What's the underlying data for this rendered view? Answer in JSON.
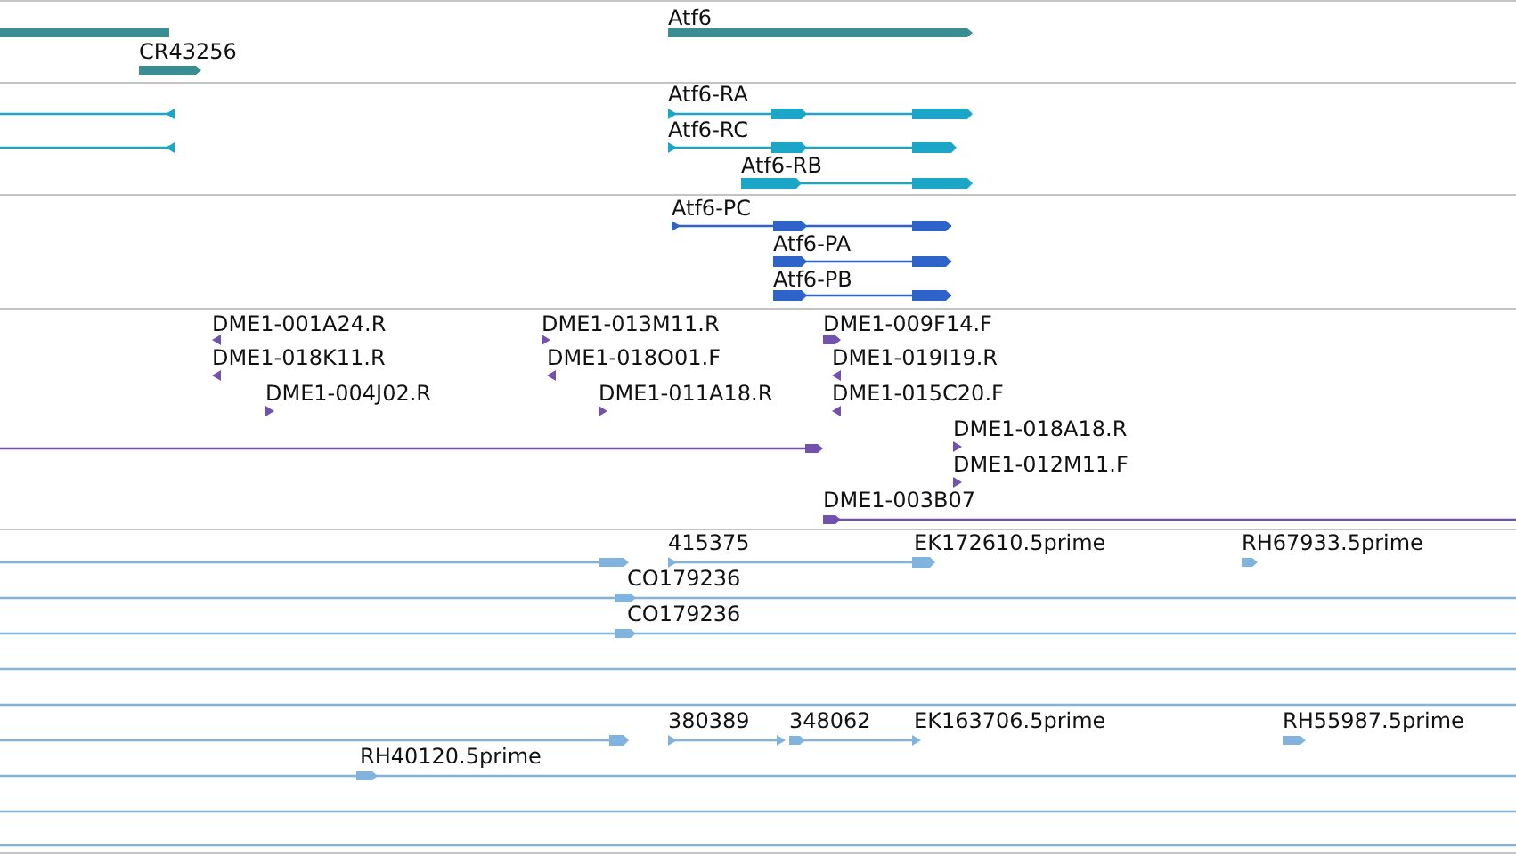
{
  "tracks": [
    {
      "kind": "gene",
      "labels": [
        "Atf6",
        "CR43256"
      ]
    },
    {
      "kind": "transcript",
      "labels": [
        "Atf6-RA",
        "Atf6-RC",
        "Atf6-RB"
      ]
    },
    {
      "kind": "protein",
      "labels": [
        "Atf6-PC",
        "Atf6-PA",
        "Atf6-PB"
      ]
    },
    {
      "kind": "clone",
      "labels": [
        "DME1-001A24.R",
        "DME1-013M11.R",
        "DME1-009F14.F",
        "DME1-018K11.R",
        "DME1-018O01.F",
        "DME1-019I19.R",
        "DME1-004J02.R",
        "DME1-011A18.R",
        "DME1-015C20.F",
        "DME1-018A18.R",
        "DME1-012M11.F",
        "DME1-003B07"
      ]
    },
    {
      "kind": "est",
      "labels": [
        "415375",
        "EK172610.5prime",
        "RH67933.5prime",
        "CO179236",
        "CO179236",
        "380389",
        "348062",
        "EK163706.5prime",
        "RH55987.5prime",
        "RH40120.5prime"
      ]
    }
  ]
}
